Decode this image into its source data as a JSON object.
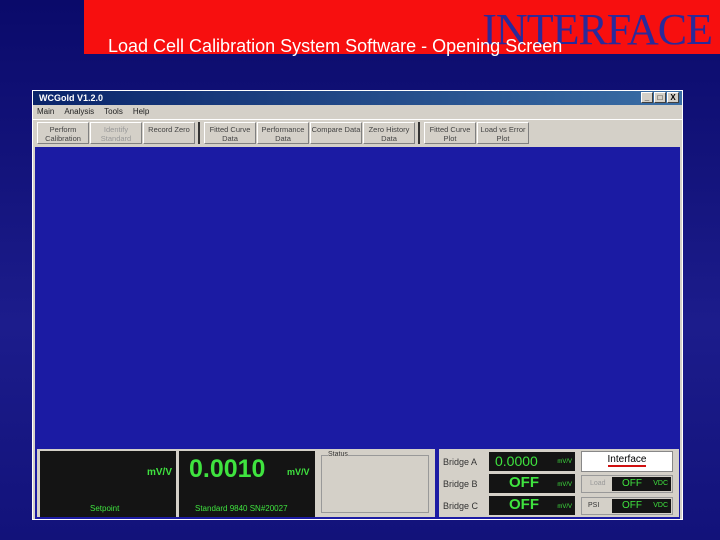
{
  "slide": {
    "title": "Load Cell Calibration System Software - Opening Screen",
    "logo": "INTERFACE"
  },
  "window": {
    "title": "WCGold  V1.2.0",
    "controls": [
      "_",
      "□",
      "X"
    ]
  },
  "menu": [
    "Main",
    "Analysis",
    "Tools",
    "Help"
  ],
  "toolbar": [
    {
      "label": "Perform Calibration",
      "enabled": true
    },
    {
      "label": "Identify Standard",
      "enabled": false
    },
    {
      "label": "Record Zero",
      "enabled": true
    },
    {
      "label": "Fitted Curve Data",
      "enabled": true
    },
    {
      "label": "Performance Data",
      "enabled": true
    },
    {
      "label": "Compare Data",
      "enabled": true
    },
    {
      "label": "Zero History Data",
      "enabled": true
    },
    {
      "label": "Fitted Curve Plot",
      "enabled": true
    },
    {
      "label": "Load vs Error Plot",
      "enabled": true
    }
  ],
  "setpoint": {
    "unit": "mV/V",
    "label": "Setpoint"
  },
  "standard": {
    "value": "0.0010",
    "unit": "mV/V",
    "label": "Standard 9840 SN#20027"
  },
  "status": {
    "label": "Status"
  },
  "bridges": [
    {
      "label": "Bridge A",
      "value": "0.0000",
      "unit": "mV/V"
    },
    {
      "label": "Bridge B",
      "value": "OFF",
      "unit": "mV/V"
    },
    {
      "label": "Bridge C",
      "value": "OFF",
      "unit": "mV/V"
    }
  ],
  "brand_button": "Interface",
  "aux": [
    {
      "label": "Load",
      "value": "OFF",
      "unit": "VDC"
    },
    {
      "label": "PSI",
      "value": "OFF",
      "unit": "VDC"
    }
  ]
}
